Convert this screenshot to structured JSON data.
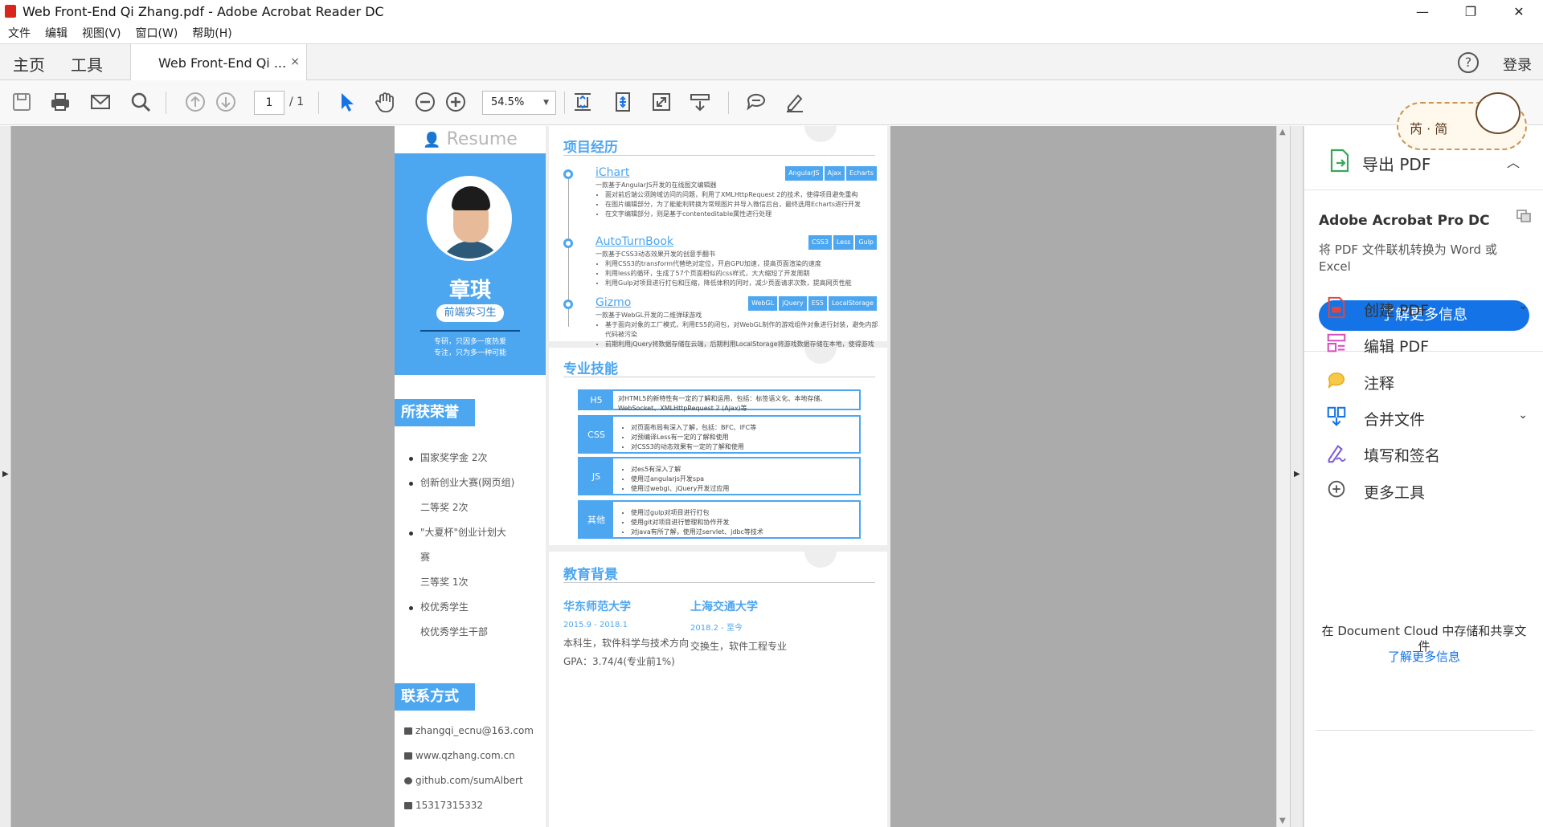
{
  "window": {
    "title": "Web Front-End Qi Zhang.pdf - Adobe Acrobat Reader DC",
    "min": "—",
    "max": "❐",
    "close": "✕"
  },
  "menu": [
    "文件",
    "编辑",
    "视图(V)",
    "窗口(W)",
    "帮助(H)"
  ],
  "tabs": {
    "home": "主页",
    "tools": "工具",
    "doc": "Web Front-End Qi ...",
    "close": "×",
    "help": "?",
    "login": "登录"
  },
  "toolbar": {
    "page": "1",
    "total": "/ 1",
    "zoom": "54.5%"
  },
  "right_panel": {
    "export": "导出 PDF",
    "product": "Adobe Acrobat Pro DC",
    "product_desc": "将 PDF 文件联机转换为 Word 或 Excel",
    "learn_more": "了解更多信息",
    "tools": [
      {
        "label": "创建 PDF",
        "chevron": "⌄"
      },
      {
        "label": "编辑 PDF",
        "chevron": ""
      },
      {
        "label": "注释",
        "chevron": ""
      },
      {
        "label": "合并文件",
        "chevron": "⌄"
      },
      {
        "label": "填写和签名",
        "chevron": ""
      },
      {
        "label": "更多工具",
        "chevron": ""
      }
    ],
    "cloud_text": "在 Document Cloud 中存储和共享文件",
    "cloud_link": "了解更多信息"
  },
  "sticker": {
    "text": "芮 · 简"
  },
  "resume": {
    "header": "Resume",
    "name": "章琪",
    "role": "前端实习生",
    "motto": [
      "专研，只因多一度热爱",
      "专注，只为多一种可能"
    ],
    "honors_title": "所获荣誉",
    "honors": [
      {
        "text": "国家奖学金 2次",
        "bullet": true
      },
      {
        "text": "创新创业大赛(网页组)",
        "bullet": true
      },
      {
        "text": "二等奖 2次",
        "bullet": false
      },
      {
        "text": "\"大夏杯\"创业计划大",
        "bullet": true
      },
      {
        "text": "赛",
        "bullet": false
      },
      {
        "text": "三等奖 1次",
        "bullet": false
      },
      {
        "text": "校优秀学生",
        "bullet": true
      },
      {
        "text": "校优秀学生干部",
        "bullet": false
      }
    ],
    "contact_title": "联系方式",
    "contacts": [
      "zhangqi_ecnu@163.com",
      "www.qzhang.com.cn",
      "github.com/sumAlbert",
      "15317315332"
    ],
    "projects_title": "项目经历",
    "projects": [
      {
        "name": "iChart",
        "tags": [
          "AngularJS",
          "Ajax",
          "Echarts"
        ],
        "sub": "一款基于AngularJS开发的在线图文编辑器",
        "items": [
          "面对前后端公须跨域访问的问题，利用了XMLHttpRequest 2的技术，使得项目避免重构",
          "在图片编辑部分，为了能能利转换为常规图片并导入微信后台，最终选用Echarts进行开发",
          "在文字编辑部分，则是基于contenteditable属性进行处理"
        ]
      },
      {
        "name": "AutoTurnBook",
        "tags": [
          "CSS3",
          "Less",
          "Gulp"
        ],
        "sub": "一款基于CSS3动态效果开发的创意手翻书",
        "items": [
          "利用CSS3的transform代替绝对定位，开启GPU加速，提高页面渲染的速度",
          "利用less的循环，生成了57个页面相似的css样式，大大缩短了开发周期",
          "利用Gulp对项目进行打包和压缩，降低体积的同时，减少页面请求次数，提高网页性能"
        ]
      },
      {
        "name": "Gizmo",
        "tags": [
          "WebGL",
          "jQuery",
          "ES5",
          "LocalStorage"
        ],
        "sub": "一款基于WebGL开发的二维弹球游戏",
        "items": [
          "基于面向对象的工厂模式，利用ES5的闭包，对WebGL制作的游戏组件对象进行封装，避免内部代码被污染",
          "前期利用jQuery将数据存储在云端，后期利用LocalStorage将游戏数据存储在本地，使得游戏可以离线运行"
        ]
      }
    ],
    "skills_title": "专业技能",
    "skills": [
      {
        "key": "H5",
        "desc": "对HTML5的新特性有一定的了解和运用，包括：标签语义化、本地存储、WebSocket、XMLHttpRequest 2 (Ajax)等",
        "items": []
      },
      {
        "key": "CSS",
        "desc": "",
        "items": [
          "对页面布局有深入了解，包括：BFC、IFC等",
          "对预编译Less有一定的了解和使用",
          "对CSS3的动态效果有一定的了解和使用"
        ]
      },
      {
        "key": "JS",
        "desc": "",
        "items": [
          "对es5有深入了解",
          "使用过angularjs开发spa",
          "使用过webgl、jQuery开发过应用"
        ]
      },
      {
        "key": "其他",
        "desc": "",
        "items": [
          "使用过gulp对项目进行打包",
          "使用git对项目进行管理和协作开发",
          "对java有所了解，使用过servlet、jdbc等技术"
        ]
      }
    ],
    "edu_title": "教育背景",
    "edu": [
      {
        "school": "华东师范大学",
        "date": "2015.9 - 2018.1",
        "detail": "本科生，软件科学与技术方向",
        "extra": "GPA：3.74/4(专业前1%)"
      },
      {
        "school": "上海交通大学",
        "date": "2018.2 - 至今",
        "detail": "交换生，软件工程专业",
        "extra": ""
      }
    ]
  }
}
